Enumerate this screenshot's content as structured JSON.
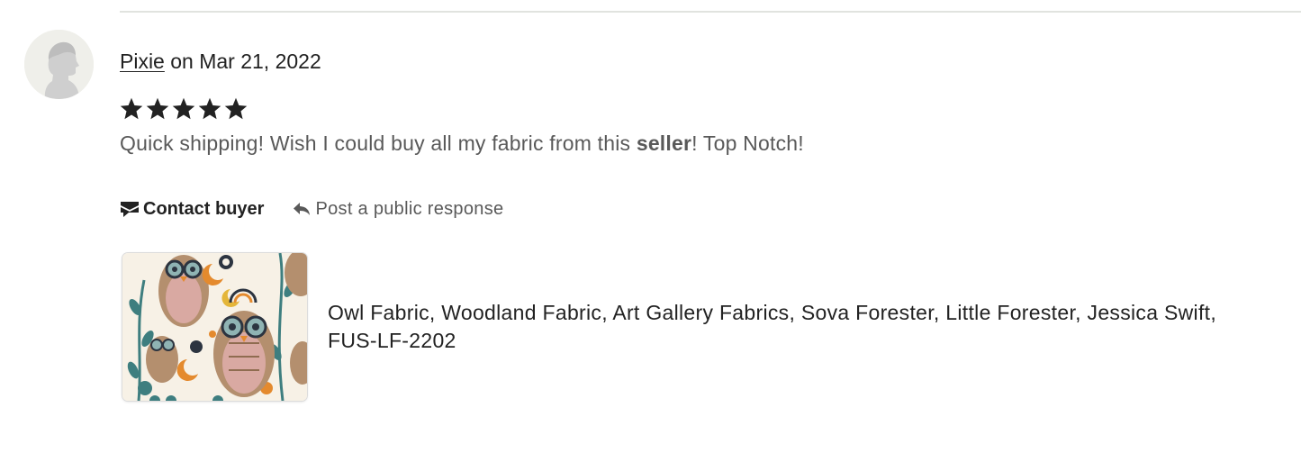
{
  "review": {
    "reviewer_name": "Pixie",
    "date_text": " on Mar 21, 2022",
    "rating": 5,
    "max_rating": 5,
    "text_before": "Quick shipping! Wish I could buy all my fabric from this ",
    "text_highlight": "seller",
    "text_after": "! Top Notch!"
  },
  "actions": {
    "contact_label": "Contact buyer",
    "contact_icon": "envelope-icon",
    "respond_label": "Post a public response",
    "respond_icon": "reply-arrow-icon"
  },
  "product": {
    "title": "Owl Fabric, Woodland Fabric, Art Gallery Fabrics, Sova Forester, Little Forester, Jessica Swift, FUS-LF-2202"
  },
  "colors": {
    "text_primary": "#222222",
    "text_secondary": "#595959",
    "star": "#222222",
    "avatar_bg": "#efefea",
    "divider": "#e1e3df"
  }
}
